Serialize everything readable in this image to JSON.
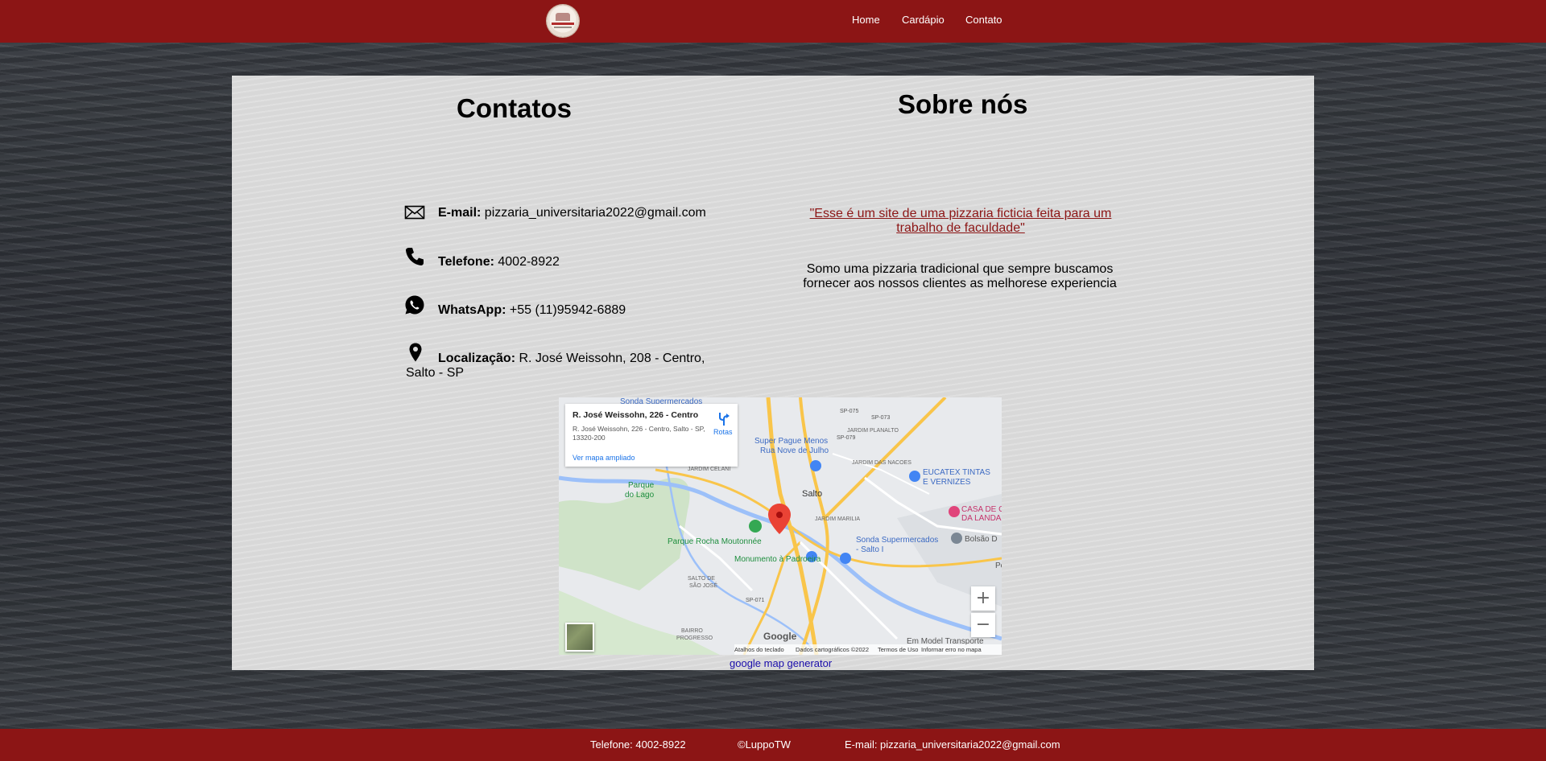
{
  "header": {
    "nav": [
      {
        "label": "Home"
      },
      {
        "label": "Cardápio"
      },
      {
        "label": "Contato"
      }
    ]
  },
  "contacts": {
    "title": "Contatos",
    "email_label": "E-mail:",
    "email_value": " pizzaria_universitaria2022@gmail.com",
    "phone_label": "Telefone:",
    "phone_value": " 4002-8922",
    "whatsapp_label": "WhatsApp:",
    "whatsapp_value": " +55 (11)95942-6889",
    "location_label": "Localização:",
    "location_value": " R. José Weissohn, 208 - Centro,",
    "location_value2": "Salto - SP"
  },
  "about": {
    "title": "Sobre nós",
    "link_text": "\"Esse é um site de uma pizzaria ficticia feita para um trabalho de faculdade\"",
    "text": "Somo uma pizzaria tradicional que sempre buscamos fornecer aos nossos clientes as melhorese experiencia"
  },
  "map": {
    "card_title": "R. José Weissohn, 226 - Centro",
    "card_address": "R. José Weissohn, 226 - Centro, Salto - SP, 13320-200",
    "card_link": "Ver mapa ampliado",
    "directions_label": "Rotas",
    "zoom_in": "+",
    "zoom_out": "−",
    "google": "Google",
    "footer": {
      "shortcuts": "Atalhos do teclado",
      "data": "Dados cartográficos ©2022",
      "terms": "Termos de Uso",
      "report": "Informar erro no mapa"
    },
    "labels": {
      "sonda_top": "Sonda Supermercados",
      "super_pague": "Super Pague Menos",
      "rua_nove": "Rua Nove de Julho",
      "jardim_planalto": "JARDIM PLANALTO",
      "jardim_das_nacoes": "JARDIM DAS NACOES",
      "eucatex": "EUCATEX TINTAS",
      "eucatex2": "E VERNIZES",
      "jardim_celani": "JARDIM CELANI",
      "parque_lago": "Parque",
      "parque_lago2": "do Lago",
      "salto": "Salto",
      "jardim_marilia": "JARDIM MARILIA",
      "casa_de": "CASA DE C",
      "da_landa": "DA LANDA",
      "parque_rocha": "Parque Rocha Moutonnée",
      "sonda_salto": "Sonda Supermercados",
      "sonda_salto2": "- Salto I",
      "bolsao": "Bolsão D",
      "monumento": "Monumento à Padroeira",
      "salto_de_sao_jose": "SALTO DE",
      "salto_de_sao_jose2": "SÃO JOSÉ",
      "bairro_progresso": "BAIRRO",
      "bairro_progresso2": "PROGRESSO",
      "sp075": "SP-075",
      "sp073": "SP-073",
      "sp079": "SP-079",
      "sp071": "SP-071",
      "p": "Pc",
      "em_model": "Em Model Transporte"
    }
  },
  "generator_link": "google map generator",
  "footer": {
    "phone": "Telefone: 4002-8922",
    "copyright": "©LuppoTW",
    "email": "E-mail: pizzaria_universitaria2022@gmail.com"
  },
  "colors": {
    "brand_red": "#8c1515",
    "panel": "#dddddd"
  }
}
